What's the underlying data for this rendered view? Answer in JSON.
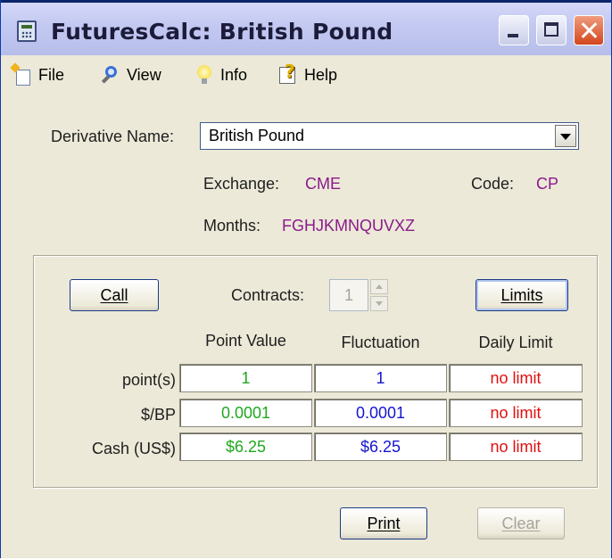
{
  "window": {
    "title": "FuturesCalc: British Pound"
  },
  "menu": {
    "file": "File",
    "view": "View",
    "info": "Info",
    "help": "Help"
  },
  "derivative": {
    "label": "Derivative Name:",
    "selected": "British Pound"
  },
  "exchange": {
    "label": "Exchange:",
    "value": "CME"
  },
  "code": {
    "label": "Code:",
    "value": "CP"
  },
  "months": {
    "label": "Months:",
    "value": "FGHJKMNQUVXZ"
  },
  "controls": {
    "call_label": "Call",
    "contracts_label": "Contracts:",
    "contracts_value": "1",
    "limits_label": "Limits"
  },
  "table": {
    "columns": [
      "Point Value",
      "Fluctuation",
      "Daily Limit"
    ],
    "rows": [
      {
        "label": "point(s)",
        "values": [
          "1",
          "1",
          "no limit"
        ]
      },
      {
        "label": "$/BP",
        "values": [
          "0.0001",
          "0.0001",
          "no limit"
        ]
      },
      {
        "label": "Cash (US$)",
        "values": [
          "$6.25",
          "$6.25",
          "no limit"
        ]
      }
    ]
  },
  "footer": {
    "print_label": "Print",
    "clear_label": "Clear"
  },
  "colors": {
    "title_bar": "#c3c9f1",
    "face": "#ece9d8",
    "purple_value": "#8b1a8b",
    "point_value": "#20a820",
    "fluctuation": "#1515d0",
    "daily_limit": "#e01010"
  }
}
